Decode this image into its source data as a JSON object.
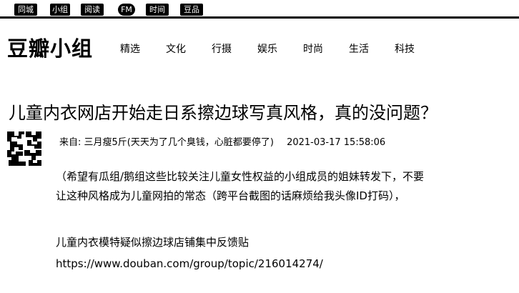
{
  "topbar": {
    "items": [
      "同城",
      "小组",
      "阅读",
      "FM",
      "时间",
      "豆品"
    ]
  },
  "header": {
    "logo": "豆瓣小组",
    "nav": [
      "精选",
      "文化",
      "行摄",
      "娱乐",
      "时尚",
      "生活",
      "科技"
    ]
  },
  "post": {
    "title": "儿童内衣网店开始走日系擦边球写真风格，真的没问题？",
    "from_label": "来自:",
    "author": "三月瘦5斤(天天为了几个臭钱，心脏都要停了)",
    "time": "2021-03-17 15:58:06",
    "paragraph1_line1": "（希望有瓜组/鹅组这些比较关注儿童女性权益的小组成员的姐妹转发下，不要",
    "paragraph1_line2": "让这种风格成为儿童网拍的常态（跨平台截图的话麻烦给我头像ID打码），",
    "paragraph2": "儿童内衣模特疑似擦边球店铺集中反馈贴",
    "link": "https://www.douban.com/group/topic/216014274/"
  }
}
